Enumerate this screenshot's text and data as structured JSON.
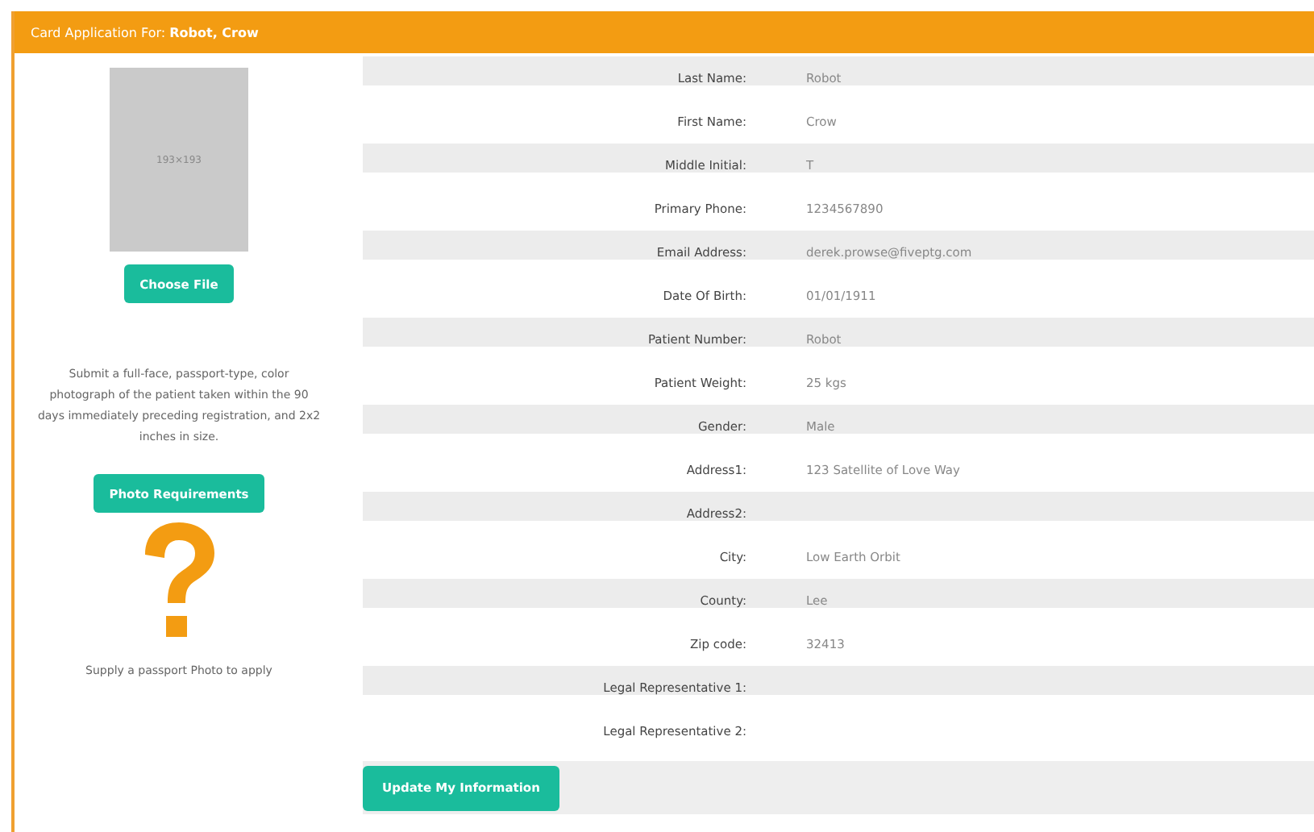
{
  "header": {
    "title": "Card Application For: ",
    "name": "Robot, Crow"
  },
  "photo": {
    "placeholder": "193×193",
    "choose_button": "Choose File",
    "instructions": "Submit a full-face, passport-type, color photograph of the patient taken within the 90 days immediately preceding registration, and 2x2 inches in size.",
    "requirements_button": "Photo Requirements",
    "note": "Supply a passport Photo to apply"
  },
  "fields": [
    {
      "label": "Last Name:",
      "value": "Robot"
    },
    {
      "label": "First Name:",
      "value": "Crow"
    },
    {
      "label": "Middle Initial:",
      "value": "T"
    },
    {
      "label": "Primary Phone:",
      "value": "1234567890"
    },
    {
      "label": "Email Address:",
      "value": "derek.prowse@fiveptg.com"
    },
    {
      "label": "Date Of Birth:",
      "value": "01/01/1911"
    },
    {
      "label": "Patient Number:",
      "value": "Robot"
    },
    {
      "label": "Patient Weight:",
      "value": "25 kgs"
    },
    {
      "label": "Gender:",
      "value": "Male"
    },
    {
      "label": "Address1:",
      "value": "123 Satellite of Love Way"
    },
    {
      "label": "Address2:"
    },
    {
      "label": "City:",
      "value": "Low Earth Orbit"
    },
    {
      "label": "County:",
      "value": "Lee"
    },
    {
      "label": "Zip code:",
      "value": "32413"
    },
    {
      "label": "Legal Representative 1:"
    },
    {
      "label": "Legal Representative 2:"
    }
  ],
  "update_button": "Update My Information"
}
